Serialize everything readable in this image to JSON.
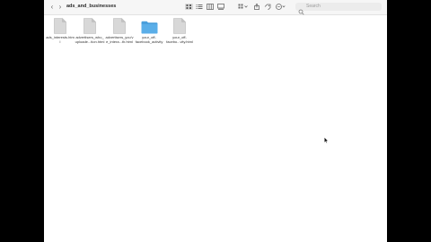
{
  "window": {
    "title": "ads_and_businesses"
  },
  "toolbar": {
    "back_label": "‹",
    "forward_label": "›",
    "search_placeholder": "Search"
  },
  "files": [
    {
      "name": "ads_interests.html",
      "line1": "ads_interests.htm",
      "line2": "l",
      "kind": "html-document-icon"
    },
    {
      "name": "advertisers_who_uploaded...tion.html",
      "line1": "advertisers_who_",
      "line2": "uploade...tion.html",
      "kind": "html-document-icon"
    },
    {
      "name": "advertisers_you've_intera...th.html",
      "line1": "advertisers_you'v",
      "line2": "e_intera...th.html",
      "kind": "html-document-icon"
    },
    {
      "name": "your_off-facebook_activity",
      "line1": "your_off-",
      "line2": "facebook_activity",
      "kind": "folder-icon"
    },
    {
      "name": "your_off-facebo...vity.html",
      "line1": "your_off-",
      "line2": "facebo...vity.html",
      "kind": "html-document-icon"
    }
  ],
  "colors": {
    "folder": "#5aaee8",
    "folder_tab": "#4a9fdc",
    "document": "#d8d8d8",
    "accent": "#2b2b2b"
  }
}
